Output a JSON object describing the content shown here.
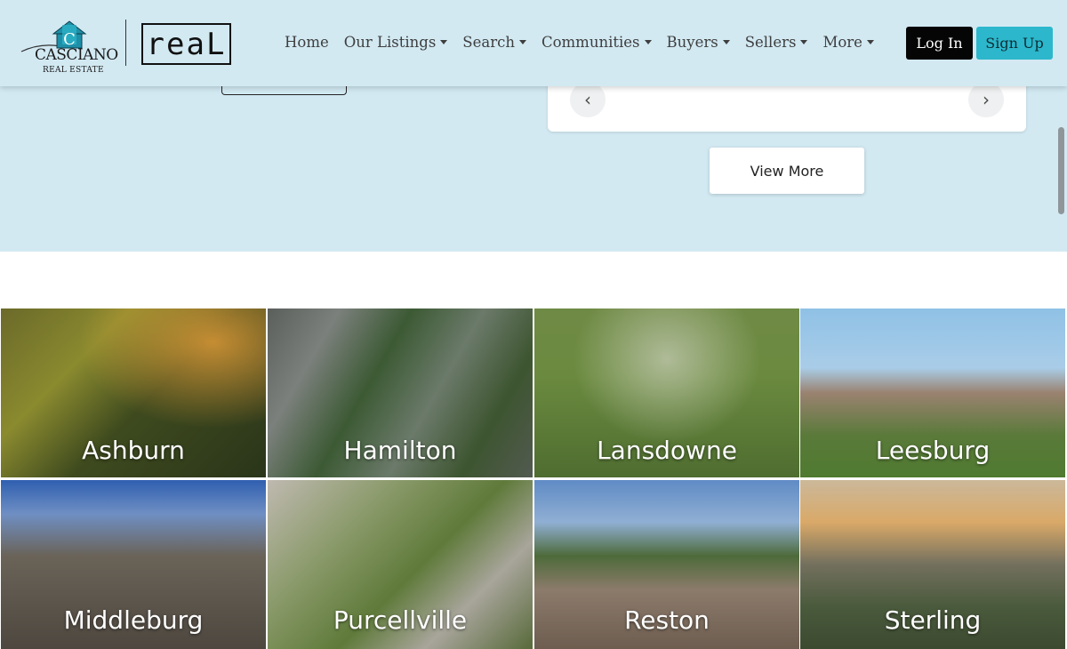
{
  "brand": {
    "logo_name": "CASCIANO",
    "logo_sub": "REAL ESTATE",
    "partner_logo": "reaL"
  },
  "nav": {
    "items": [
      {
        "label": "Home",
        "dropdown": false
      },
      {
        "label": "Our Listings",
        "dropdown": true
      },
      {
        "label": "Search",
        "dropdown": true
      },
      {
        "label": "Communities",
        "dropdown": true
      },
      {
        "label": "Buyers",
        "dropdown": true
      },
      {
        "label": "Sellers",
        "dropdown": true
      },
      {
        "label": "More",
        "dropdown": true
      }
    ],
    "login_label": "Log In",
    "signup_label": "Sign Up"
  },
  "carousel": {
    "prev_icon": "chevron-left-icon",
    "next_icon": "chevron-right-icon",
    "prev_glyph": "‹",
    "next_glyph": "›",
    "view_more_label": "View More"
  },
  "communities": [
    {
      "name": "Ashburn"
    },
    {
      "name": "Hamilton"
    },
    {
      "name": "Lansdowne"
    },
    {
      "name": "Leesburg"
    },
    {
      "name": "Middleburg"
    },
    {
      "name": "Purcellville"
    },
    {
      "name": "Reston"
    },
    {
      "name": "Sterling"
    }
  ],
  "colors": {
    "hero_bg": "#d2e9f2",
    "login_bg": "#050505",
    "signup_bg": "#2cb7cc",
    "logo_teal": "#1e8fa8"
  }
}
